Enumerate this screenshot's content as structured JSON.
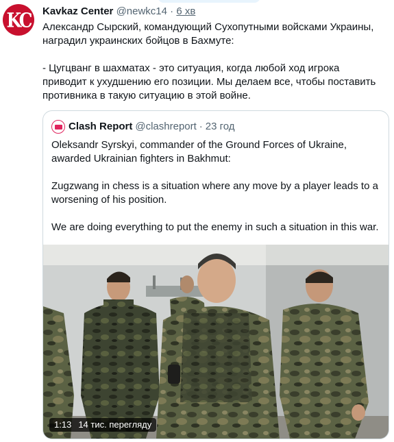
{
  "tweet": {
    "avatar_text": "KC",
    "author_name": "Kavkaz Center",
    "handle": "@newkc14",
    "separator": "·",
    "time": "6 хв",
    "paragraphs": [
      "Александр Сырский, командующий Сухопутными войсками Украины, наградил украинских бойцов в Бахмуте:",
      "- Цугцванг в шахматах - это ситуация, когда любой ход игрока приводит к ухудшению его позиции. Мы делаем все, чтобы поставить противника в такую ситуацию в этой войне."
    ]
  },
  "quoted_tweet": {
    "author_name": "Clash Report",
    "handle": "@clashreport",
    "separator": "·",
    "time": "23 год",
    "paragraphs": [
      "Oleksandr Syrskyi, commander of the Ground Forces of Ukraine, awarded Ukrainian fighters in Bakhmut:",
      "Zugzwang in chess is a situation where any move by a player leads to a worsening of his position.",
      "We are doing everything to put the enemy in such a situation in this war."
    ],
    "video": {
      "duration": "1:13",
      "views": "14 тис. перегляду"
    }
  },
  "colors": {
    "brand_red": "#c8102e",
    "clash_red": "#e0245e",
    "secondary_text": "#536471",
    "border": "#cfd9de",
    "camo_dark": "#3a3e2c",
    "camo_mid": "#5b6244",
    "camo_light": "#7d7a55"
  }
}
